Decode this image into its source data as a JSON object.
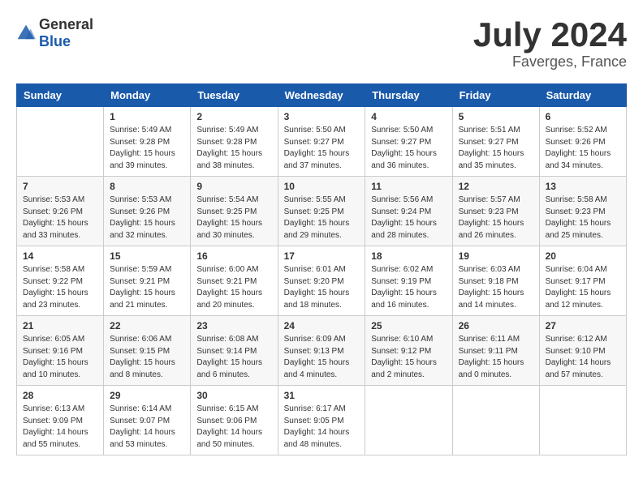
{
  "logo": {
    "general": "General",
    "blue": "Blue"
  },
  "title": {
    "month": "July 2024",
    "location": "Faverges, France"
  },
  "weekdays": [
    "Sunday",
    "Monday",
    "Tuesday",
    "Wednesday",
    "Thursday",
    "Friday",
    "Saturday"
  ],
  "weeks": [
    [
      {
        "day": "",
        "info": ""
      },
      {
        "day": "1",
        "info": "Sunrise: 5:49 AM\nSunset: 9:28 PM\nDaylight: 15 hours\nand 39 minutes."
      },
      {
        "day": "2",
        "info": "Sunrise: 5:49 AM\nSunset: 9:28 PM\nDaylight: 15 hours\nand 38 minutes."
      },
      {
        "day": "3",
        "info": "Sunrise: 5:50 AM\nSunset: 9:27 PM\nDaylight: 15 hours\nand 37 minutes."
      },
      {
        "day": "4",
        "info": "Sunrise: 5:50 AM\nSunset: 9:27 PM\nDaylight: 15 hours\nand 36 minutes."
      },
      {
        "day": "5",
        "info": "Sunrise: 5:51 AM\nSunset: 9:27 PM\nDaylight: 15 hours\nand 35 minutes."
      },
      {
        "day": "6",
        "info": "Sunrise: 5:52 AM\nSunset: 9:26 PM\nDaylight: 15 hours\nand 34 minutes."
      }
    ],
    [
      {
        "day": "7",
        "info": "Sunrise: 5:53 AM\nSunset: 9:26 PM\nDaylight: 15 hours\nand 33 minutes."
      },
      {
        "day": "8",
        "info": "Sunrise: 5:53 AM\nSunset: 9:26 PM\nDaylight: 15 hours\nand 32 minutes."
      },
      {
        "day": "9",
        "info": "Sunrise: 5:54 AM\nSunset: 9:25 PM\nDaylight: 15 hours\nand 30 minutes."
      },
      {
        "day": "10",
        "info": "Sunrise: 5:55 AM\nSunset: 9:25 PM\nDaylight: 15 hours\nand 29 minutes."
      },
      {
        "day": "11",
        "info": "Sunrise: 5:56 AM\nSunset: 9:24 PM\nDaylight: 15 hours\nand 28 minutes."
      },
      {
        "day": "12",
        "info": "Sunrise: 5:57 AM\nSunset: 9:23 PM\nDaylight: 15 hours\nand 26 minutes."
      },
      {
        "day": "13",
        "info": "Sunrise: 5:58 AM\nSunset: 9:23 PM\nDaylight: 15 hours\nand 25 minutes."
      }
    ],
    [
      {
        "day": "14",
        "info": "Sunrise: 5:58 AM\nSunset: 9:22 PM\nDaylight: 15 hours\nand 23 minutes."
      },
      {
        "day": "15",
        "info": "Sunrise: 5:59 AM\nSunset: 9:21 PM\nDaylight: 15 hours\nand 21 minutes."
      },
      {
        "day": "16",
        "info": "Sunrise: 6:00 AM\nSunset: 9:21 PM\nDaylight: 15 hours\nand 20 minutes."
      },
      {
        "day": "17",
        "info": "Sunrise: 6:01 AM\nSunset: 9:20 PM\nDaylight: 15 hours\nand 18 minutes."
      },
      {
        "day": "18",
        "info": "Sunrise: 6:02 AM\nSunset: 9:19 PM\nDaylight: 15 hours\nand 16 minutes."
      },
      {
        "day": "19",
        "info": "Sunrise: 6:03 AM\nSunset: 9:18 PM\nDaylight: 15 hours\nand 14 minutes."
      },
      {
        "day": "20",
        "info": "Sunrise: 6:04 AM\nSunset: 9:17 PM\nDaylight: 15 hours\nand 12 minutes."
      }
    ],
    [
      {
        "day": "21",
        "info": "Sunrise: 6:05 AM\nSunset: 9:16 PM\nDaylight: 15 hours\nand 10 minutes."
      },
      {
        "day": "22",
        "info": "Sunrise: 6:06 AM\nSunset: 9:15 PM\nDaylight: 15 hours\nand 8 minutes."
      },
      {
        "day": "23",
        "info": "Sunrise: 6:08 AM\nSunset: 9:14 PM\nDaylight: 15 hours\nand 6 minutes."
      },
      {
        "day": "24",
        "info": "Sunrise: 6:09 AM\nSunset: 9:13 PM\nDaylight: 15 hours\nand 4 minutes."
      },
      {
        "day": "25",
        "info": "Sunrise: 6:10 AM\nSunset: 9:12 PM\nDaylight: 15 hours\nand 2 minutes."
      },
      {
        "day": "26",
        "info": "Sunrise: 6:11 AM\nSunset: 9:11 PM\nDaylight: 15 hours\nand 0 minutes."
      },
      {
        "day": "27",
        "info": "Sunrise: 6:12 AM\nSunset: 9:10 PM\nDaylight: 14 hours\nand 57 minutes."
      }
    ],
    [
      {
        "day": "28",
        "info": "Sunrise: 6:13 AM\nSunset: 9:09 PM\nDaylight: 14 hours\nand 55 minutes."
      },
      {
        "day": "29",
        "info": "Sunrise: 6:14 AM\nSunset: 9:07 PM\nDaylight: 14 hours\nand 53 minutes."
      },
      {
        "day": "30",
        "info": "Sunrise: 6:15 AM\nSunset: 9:06 PM\nDaylight: 14 hours\nand 50 minutes."
      },
      {
        "day": "31",
        "info": "Sunrise: 6:17 AM\nSunset: 9:05 PM\nDaylight: 14 hours\nand 48 minutes."
      },
      {
        "day": "",
        "info": ""
      },
      {
        "day": "",
        "info": ""
      },
      {
        "day": "",
        "info": ""
      }
    ]
  ]
}
